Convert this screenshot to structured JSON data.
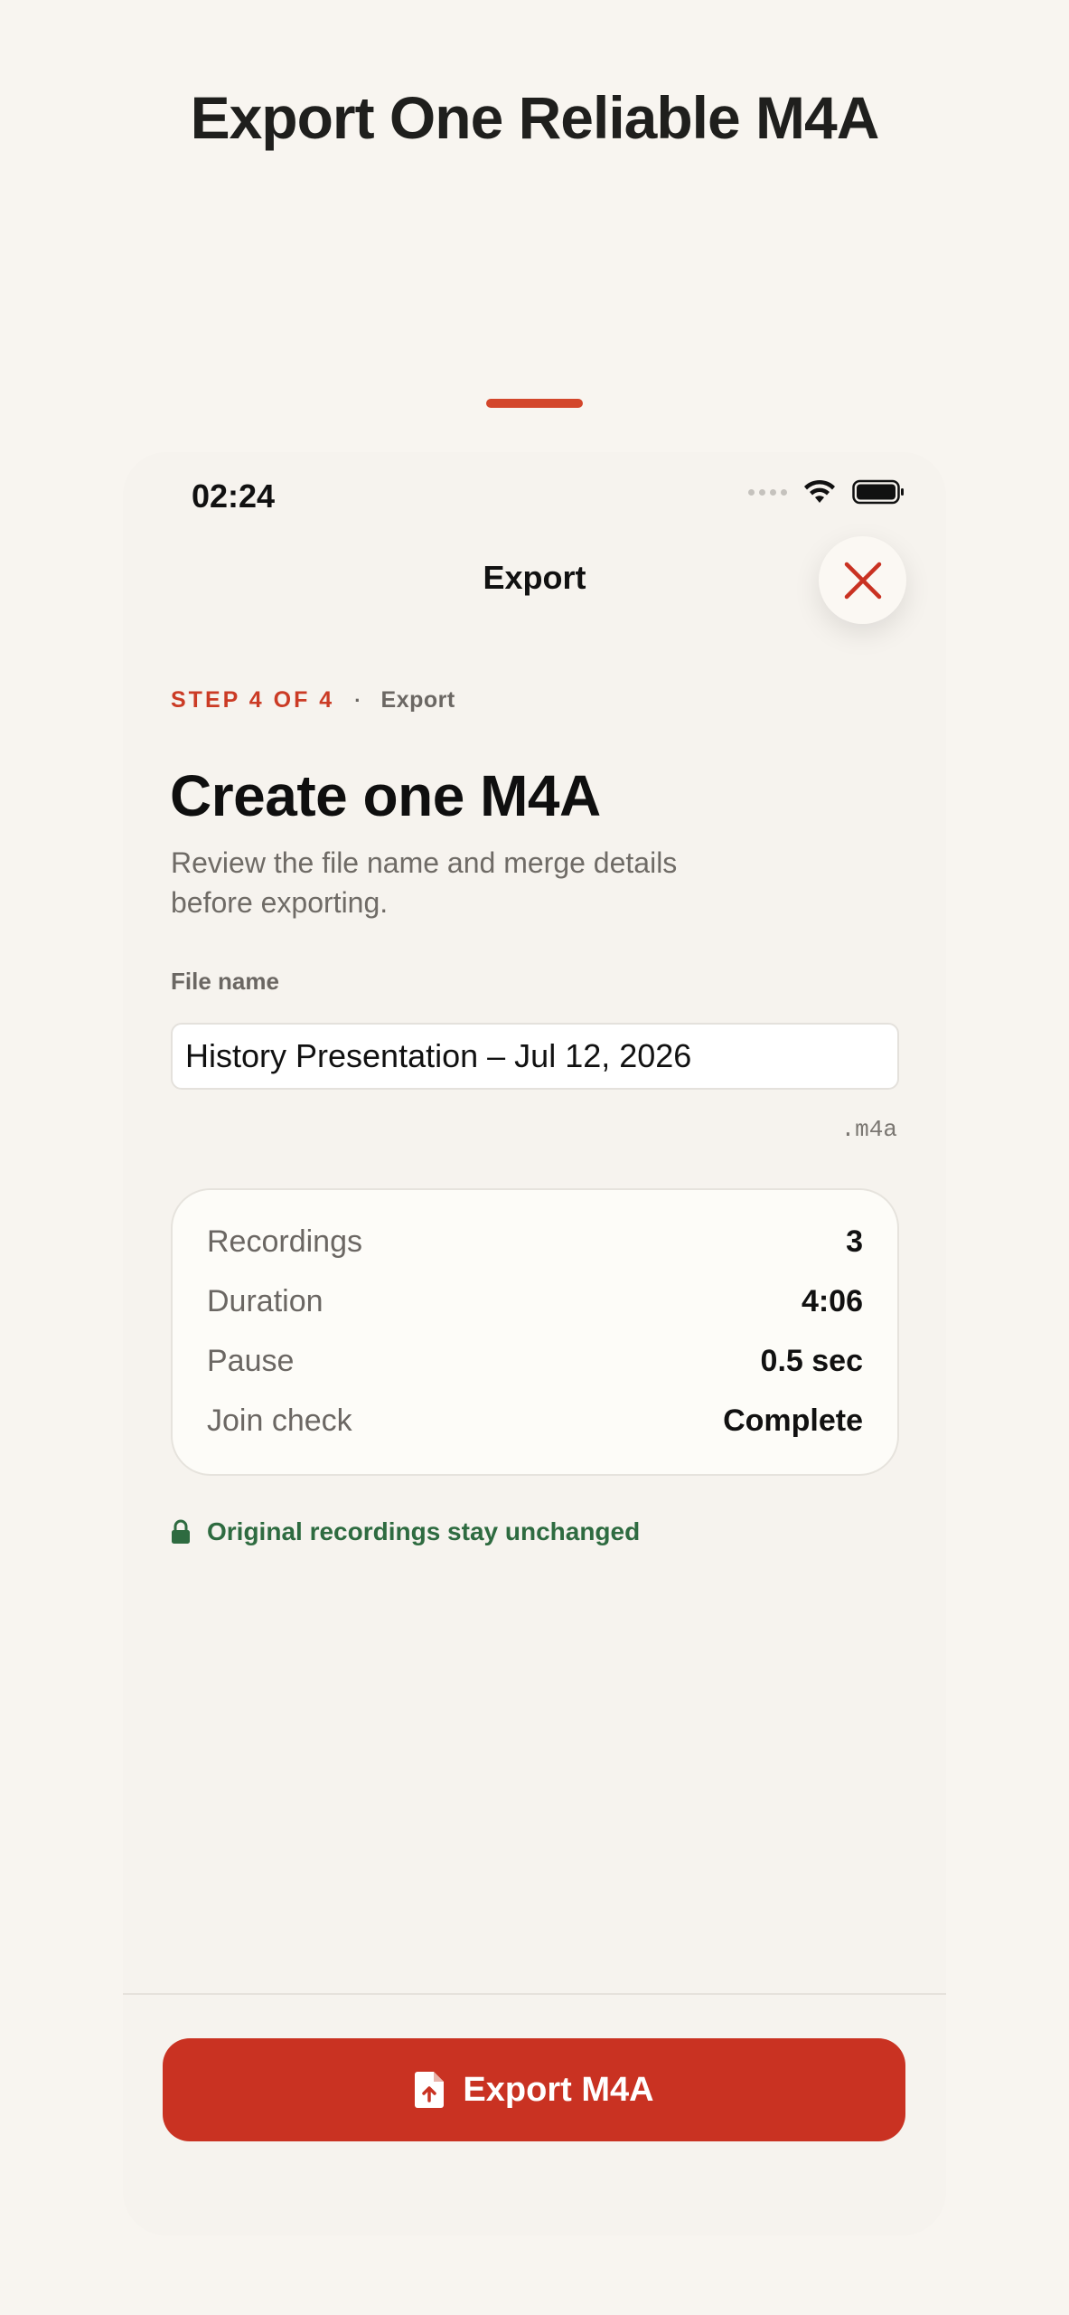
{
  "headline": "Export One Reliable M4A",
  "status_bar": {
    "time": "02:24"
  },
  "nav": {
    "title": "Export",
    "close_icon": "close-icon"
  },
  "step": {
    "label": "STEP 4 OF 4",
    "separator": "·",
    "name": "Export"
  },
  "title": "Create one M4A",
  "subtitle": "Review the file name and merge details before exporting.",
  "file_name": {
    "label": "File name",
    "value": "History Presentation – Jul 12, 2026",
    "extension": ".m4a"
  },
  "summary": [
    {
      "label": "Recordings",
      "value": "3"
    },
    {
      "label": "Duration",
      "value": "4:06"
    },
    {
      "label": "Pause",
      "value": "0.5 sec"
    },
    {
      "label": "Join check",
      "value": "Complete"
    }
  ],
  "note": {
    "text": "Original recordings stay unchanged",
    "icon": "lock-icon"
  },
  "export_button": {
    "label": "Export M4A",
    "icon": "file-export-icon"
  },
  "colors": {
    "accent": "#c93222",
    "success": "#2e6b40",
    "background": "#f8f5f0"
  }
}
